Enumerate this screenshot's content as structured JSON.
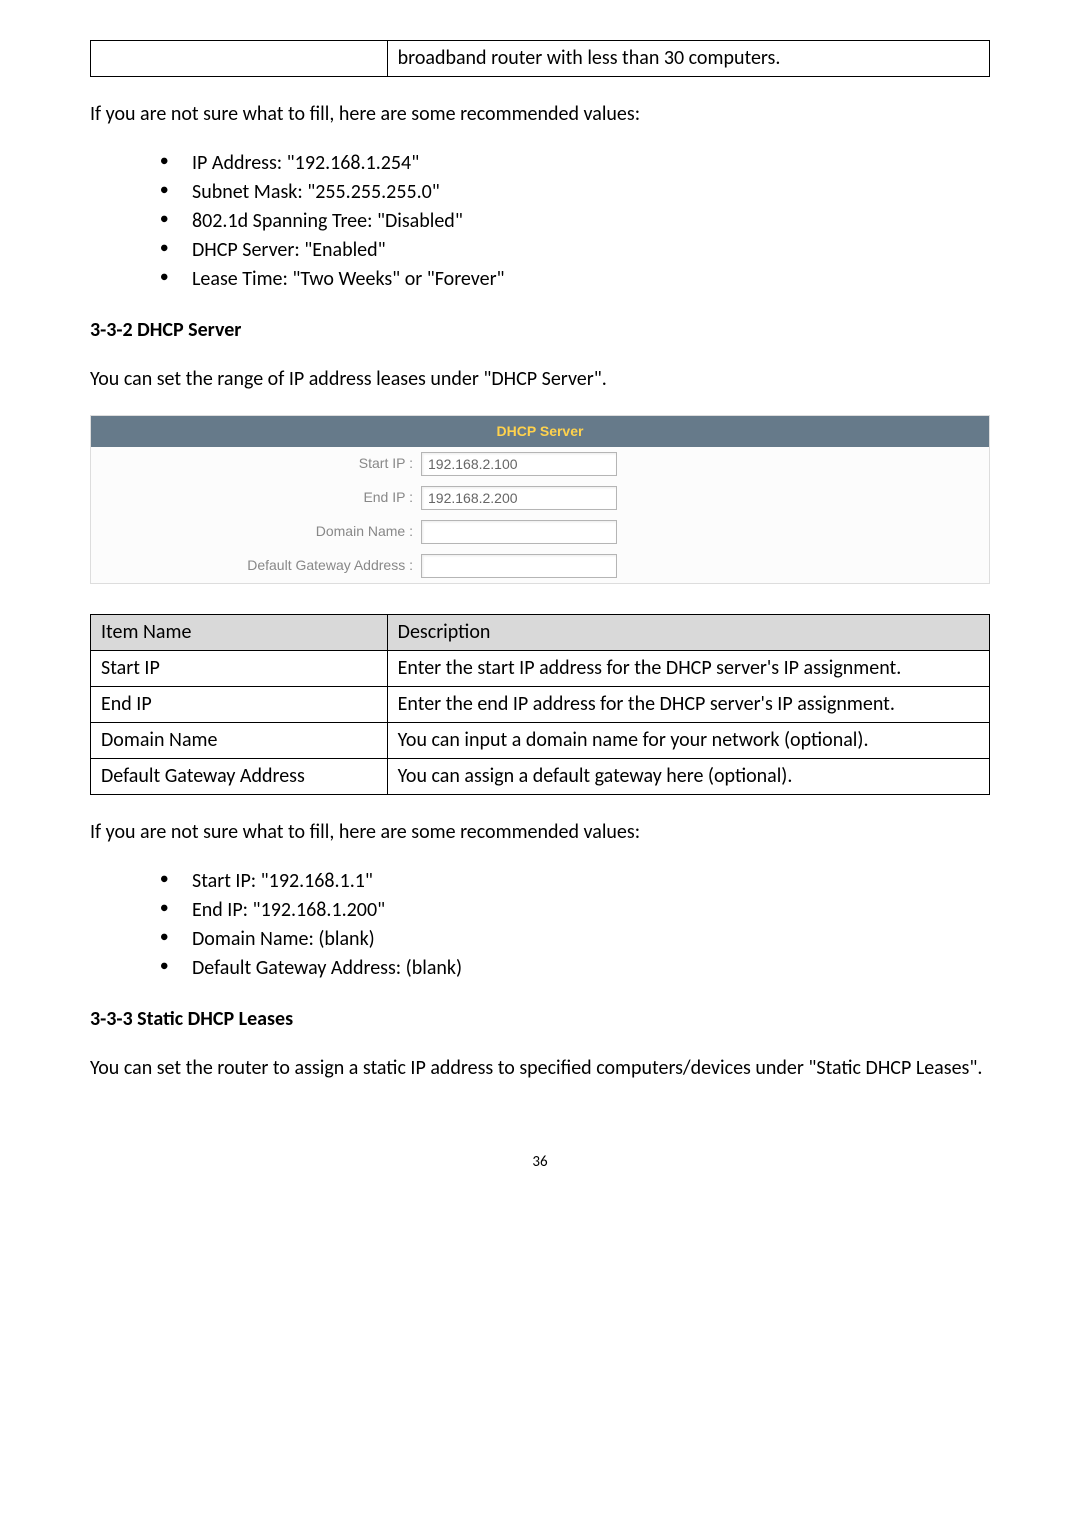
{
  "top_table": {
    "cell_right": "broadband router with less than 30 computers."
  },
  "intro1": "If you are not sure what to fill, here are some recommended values:",
  "bullets1": [
    "IP Address: \"192.168.1.254\"",
    "Subnet Mask: \"255.255.255.0\"",
    "802.1d Spanning Tree: \"Disabled\"",
    "DHCP Server: \"Enabled\"",
    "Lease Time: \"Two Weeks\" or \"Forever\""
  ],
  "section1_heading": "3-3-2 DHCP Server",
  "section1_para": "You can set the range of IP address leases under \"DHCP Server\".",
  "dhcp_panel": {
    "title": "DHCP Server",
    "rows": [
      {
        "label": "Start IP :",
        "value": "192.168.2.100"
      },
      {
        "label": "End IP :",
        "value": "192.168.2.200"
      },
      {
        "label": "Domain Name :",
        "value": ""
      },
      {
        "label": "Default Gateway Address :",
        "value": ""
      }
    ]
  },
  "desc_table": {
    "headers": [
      "Item Name",
      "Description"
    ],
    "rows": [
      [
        "Start IP",
        "Enter the start IP address for the DHCP server's IP assignment."
      ],
      [
        "End IP",
        "Enter the end IP address for the DHCP server's IP assignment."
      ],
      [
        "Domain Name",
        "You can input a domain name for your network (optional)."
      ],
      [
        "Default Gateway Address",
        "You can assign a default gateway here (optional)."
      ]
    ]
  },
  "intro2": "If you are not sure what to fill, here are some recommended values:",
  "bullets2": [
    "Start IP: \"192.168.1.1\"",
    "End IP: \"192.168.1.200\"",
    "Domain Name: (blank)",
    "Default Gateway Address: (blank)"
  ],
  "section2_heading": "3-3-3 Static DHCP Leases",
  "section2_para": "You can set the router to assign a static IP address to specified computers/devices under \"Static DHCP Leases\".",
  "page_number": "36"
}
